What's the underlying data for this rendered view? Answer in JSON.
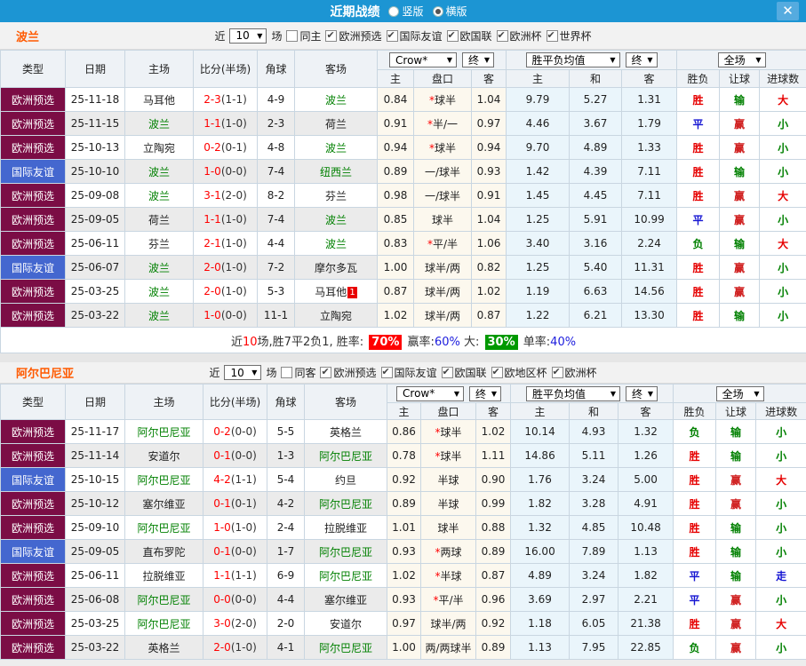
{
  "titlebar": {
    "title": "近期战绩",
    "radio_vertical": "竖版",
    "radio_horizontal": "横版",
    "selected_mode": "横版",
    "close_glyph": "✕"
  },
  "columns": {
    "type": "类型",
    "date": "日期",
    "home": "主场",
    "score": "比分(半场)",
    "corner": "角球",
    "away": "客场",
    "crow_select": "Crow*",
    "final_select": "终",
    "wdl_avg_select": "胜平负均值",
    "full_select": "全场",
    "odds_home": "主",
    "handicap": "盘口",
    "odds_away": "客",
    "avg_home": "主",
    "avg_draw": "和",
    "avg_away": "客",
    "result_wdl": "胜负",
    "result_handicap": "让球",
    "result_goals": "进球数"
  },
  "colors": {
    "titlebar_blue": "#1c95d3",
    "team_label_orange": "#ff5a00",
    "team_highlight_green": "#008000",
    "score_red": "#ff0000",
    "rate_red_bg": "#ff0000",
    "rate_green_bg": "#009900",
    "rate_blue_text": "#1c1cdd"
  },
  "type_bg_map": {
    "欧洲预选": "#7b0d45",
    "国际友谊": "#4467cf"
  },
  "result_color_map": {
    "胜": "#e60000",
    "负": "#008000",
    "平": "#1414d2",
    "赢": "#d02020",
    "输": "#008000",
    "走": "#1414d2",
    "大": "#e60000",
    "小": "#008000"
  },
  "sections": [
    {
      "team": "波兰",
      "filter": {
        "near_label": "近",
        "count": "10",
        "games_label": "场",
        "same_label": "同主",
        "same_checked": false,
        "competitions": [
          {
            "label": "欧洲预选",
            "checked": true
          },
          {
            "label": "国际友谊",
            "checked": true
          },
          {
            "label": "欧国联",
            "checked": true
          },
          {
            "label": "欧洲杯",
            "checked": true
          },
          {
            "label": "世界杯",
            "checked": true
          }
        ]
      },
      "rows": [
        {
          "type": "欧洲预选",
          "date": "25-11-18",
          "home": "马耳他",
          "home_active": false,
          "score": "2-3",
          "half": "(1-1)",
          "corners": "4-9",
          "away": "波兰",
          "away_active": true,
          "odds_home": "0.84",
          "handicap": "*球半",
          "odds_away": "1.04",
          "avg_home": "9.79",
          "avg_draw": "5.27",
          "avg_away": "1.31",
          "res_wdl": "胜",
          "res_handicap": "输",
          "res_goals": "大"
        },
        {
          "type": "欧洲预选",
          "date": "25-11-15",
          "home": "波兰",
          "home_active": true,
          "score": "1-1",
          "half": "(1-0)",
          "corners": "2-3",
          "away": "荷兰",
          "away_active": false,
          "odds_home": "0.91",
          "handicap": "*半/一",
          "odds_away": "0.97",
          "avg_home": "4.46",
          "avg_draw": "3.67",
          "avg_away": "1.79",
          "res_wdl": "平",
          "res_handicap": "赢",
          "res_goals": "小"
        },
        {
          "type": "欧洲预选",
          "date": "25-10-13",
          "home": "立陶宛",
          "home_active": false,
          "score": "0-2",
          "half": "(0-1)",
          "corners": "4-8",
          "away": "波兰",
          "away_active": true,
          "odds_home": "0.94",
          "handicap": "*球半",
          "odds_away": "0.94",
          "avg_home": "9.70",
          "avg_draw": "4.89",
          "avg_away": "1.33",
          "res_wdl": "胜",
          "res_handicap": "赢",
          "res_goals": "小"
        },
        {
          "type": "国际友谊",
          "date": "25-10-10",
          "home": "波兰",
          "home_active": true,
          "score": "1-0",
          "half": "(0-0)",
          "corners": "7-4",
          "away": "纽西兰",
          "away_active": true,
          "odds_home": "0.89",
          "handicap": "一/球半",
          "odds_away": "0.93",
          "avg_home": "1.42",
          "avg_draw": "4.39",
          "avg_away": "7.11",
          "res_wdl": "胜",
          "res_handicap": "输",
          "res_goals": "小"
        },
        {
          "type": "欧洲预选",
          "date": "25-09-08",
          "home": "波兰",
          "home_active": true,
          "score": "3-1",
          "half": "(2-0)",
          "corners": "8-2",
          "away": "芬兰",
          "away_active": false,
          "odds_home": "0.98",
          "handicap": "一/球半",
          "odds_away": "0.91",
          "avg_home": "1.45",
          "avg_draw": "4.45",
          "avg_away": "7.11",
          "res_wdl": "胜",
          "res_handicap": "赢",
          "res_goals": "大"
        },
        {
          "type": "欧洲预选",
          "date": "25-09-05",
          "home": "荷兰",
          "home_active": false,
          "score": "1-1",
          "half": "(1-0)",
          "corners": "7-4",
          "away": "波兰",
          "away_active": true,
          "odds_home": "0.85",
          "handicap": "球半",
          "odds_away": "1.04",
          "avg_home": "1.25",
          "avg_draw": "5.91",
          "avg_away": "10.99",
          "res_wdl": "平",
          "res_handicap": "赢",
          "res_goals": "小"
        },
        {
          "type": "欧洲预选",
          "date": "25-06-11",
          "home": "芬兰",
          "home_active": false,
          "score": "2-1",
          "half": "(1-0)",
          "corners": "4-4",
          "away": "波兰",
          "away_active": true,
          "odds_home": "0.83",
          "handicap": "*平/半",
          "odds_away": "1.06",
          "avg_home": "3.40",
          "avg_draw": "3.16",
          "avg_away": "2.24",
          "res_wdl": "负",
          "res_handicap": "输",
          "res_goals": "大"
        },
        {
          "type": "国际友谊",
          "date": "25-06-07",
          "home": "波兰",
          "home_active": true,
          "score": "2-0",
          "half": "(1-0)",
          "corners": "7-2",
          "away": "摩尔多瓦",
          "away_active": false,
          "odds_home": "1.00",
          "handicap": "球半/两",
          "odds_away": "0.82",
          "avg_home": "1.25",
          "avg_draw": "5.40",
          "avg_away": "11.31",
          "res_wdl": "胜",
          "res_handicap": "赢",
          "res_goals": "小"
        },
        {
          "type": "欧洲预选",
          "date": "25-03-25",
          "home": "波兰",
          "home_active": true,
          "score": "2-0",
          "half": "(1-0)",
          "corners": "5-3",
          "away": "马耳他",
          "away_active": false,
          "away_badge": "1",
          "odds_home": "0.87",
          "handicap": "球半/两",
          "odds_away": "1.02",
          "avg_home": "1.19",
          "avg_draw": "6.63",
          "avg_away": "14.56",
          "res_wdl": "胜",
          "res_handicap": "赢",
          "res_goals": "小"
        },
        {
          "type": "欧洲预选",
          "date": "25-03-22",
          "home": "波兰",
          "home_active": true,
          "score": "1-0",
          "half": "(0-0)",
          "corners": "11-1",
          "away": "立陶宛",
          "away_active": false,
          "odds_home": "1.02",
          "handicap": "球半/两",
          "odds_away": "0.87",
          "avg_home": "1.22",
          "avg_draw": "6.21",
          "avg_away": "13.30",
          "res_wdl": "胜",
          "res_handicap": "输",
          "res_goals": "小"
        }
      ],
      "summary": {
        "part1": "近",
        "count": "10",
        "part2": "场,胜7平2负1, 胜率:",
        "win_rate": "70%",
        "label_win": "赢率:",
        "win_pct": "60%",
        "label_big": "大:",
        "big_pct": "30%",
        "label_single": "单率:",
        "single_pct": "40%"
      }
    },
    {
      "team": "阿尔巴尼亚",
      "filter": {
        "near_label": "近",
        "count": "10",
        "games_label": "场",
        "same_label": "同客",
        "same_checked": false,
        "competitions": [
          {
            "label": "欧洲预选",
            "checked": true
          },
          {
            "label": "国际友谊",
            "checked": true
          },
          {
            "label": "欧国联",
            "checked": true
          },
          {
            "label": "欧地区杯",
            "checked": true
          },
          {
            "label": "欧洲杯",
            "checked": true
          }
        ]
      },
      "rows": [
        {
          "type": "欧洲预选",
          "date": "25-11-17",
          "home": "阿尔巴尼亚",
          "home_active": true,
          "score": "0-2",
          "half": "(0-0)",
          "corners": "5-5",
          "away": "英格兰",
          "away_active": false,
          "odds_home": "0.86",
          "handicap": "*球半",
          "odds_away": "1.02",
          "avg_home": "10.14",
          "avg_draw": "4.93",
          "avg_away": "1.32",
          "res_wdl": "负",
          "res_handicap": "输",
          "res_goals": "小"
        },
        {
          "type": "欧洲预选",
          "date": "25-11-14",
          "home": "安道尔",
          "home_active": false,
          "score": "0-1",
          "half": "(0-0)",
          "corners": "1-3",
          "away": "阿尔巴尼亚",
          "away_active": true,
          "odds_home": "0.78",
          "handicap": "*球半",
          "odds_away": "1.11",
          "avg_home": "14.86",
          "avg_draw": "5.11",
          "avg_away": "1.26",
          "res_wdl": "胜",
          "res_handicap": "输",
          "res_goals": "小"
        },
        {
          "type": "国际友谊",
          "date": "25-10-15",
          "home": "阿尔巴尼亚",
          "home_active": true,
          "score": "4-2",
          "half": "(1-1)",
          "corners": "5-4",
          "away": "约旦",
          "away_active": false,
          "odds_home": "0.92",
          "handicap": "半球",
          "odds_away": "0.90",
          "avg_home": "1.76",
          "avg_draw": "3.24",
          "avg_away": "5.00",
          "res_wdl": "胜",
          "res_handicap": "赢",
          "res_goals": "大"
        },
        {
          "type": "欧洲预选",
          "date": "25-10-12",
          "home": "塞尔维亚",
          "home_active": false,
          "score": "0-1",
          "half": "(0-1)",
          "corners": "4-2",
          "away": "阿尔巴尼亚",
          "away_active": true,
          "odds_home": "0.89",
          "handicap": "半球",
          "odds_away": "0.99",
          "avg_home": "1.82",
          "avg_draw": "3.28",
          "avg_away": "4.91",
          "res_wdl": "胜",
          "res_handicap": "赢",
          "res_goals": "小"
        },
        {
          "type": "欧洲预选",
          "date": "25-09-10",
          "home": "阿尔巴尼亚",
          "home_active": true,
          "score": "1-0",
          "half": "(1-0)",
          "corners": "2-4",
          "away": "拉脱维亚",
          "away_active": false,
          "odds_home": "1.01",
          "handicap": "球半",
          "odds_away": "0.88",
          "avg_home": "1.32",
          "avg_draw": "4.85",
          "avg_away": "10.48",
          "res_wdl": "胜",
          "res_handicap": "输",
          "res_goals": "小"
        },
        {
          "type": "国际友谊",
          "date": "25-09-05",
          "home": "直布罗陀",
          "home_active": false,
          "score": "0-1",
          "half": "(0-0)",
          "corners": "1-7",
          "away": "阿尔巴尼亚",
          "away_active": true,
          "odds_home": "0.93",
          "handicap": "*两球",
          "odds_away": "0.89",
          "avg_home": "16.00",
          "avg_draw": "7.89",
          "avg_away": "1.13",
          "res_wdl": "胜",
          "res_handicap": "输",
          "res_goals": "小"
        },
        {
          "type": "欧洲预选",
          "date": "25-06-11",
          "home": "拉脱维亚",
          "home_active": false,
          "score": "1-1",
          "half": "(1-1)",
          "corners": "6-9",
          "away": "阿尔巴尼亚",
          "away_active": true,
          "odds_home": "1.02",
          "handicap": "*半球",
          "odds_away": "0.87",
          "avg_home": "4.89",
          "avg_draw": "3.24",
          "avg_away": "1.82",
          "res_wdl": "平",
          "res_handicap": "输",
          "res_goals": "走"
        },
        {
          "type": "欧洲预选",
          "date": "25-06-08",
          "home": "阿尔巴尼亚",
          "home_active": true,
          "score": "0-0",
          "half": "(0-0)",
          "corners": "4-4",
          "away": "塞尔维亚",
          "away_active": false,
          "odds_home": "0.93",
          "handicap": "*平/半",
          "odds_away": "0.96",
          "avg_home": "3.69",
          "avg_draw": "2.97",
          "avg_away": "2.21",
          "res_wdl": "平",
          "res_handicap": "赢",
          "res_goals": "小"
        },
        {
          "type": "欧洲预选",
          "date": "25-03-25",
          "home": "阿尔巴尼亚",
          "home_active": true,
          "score": "3-0",
          "half": "(2-0)",
          "corners": "2-0",
          "away": "安道尔",
          "away_active": false,
          "odds_home": "0.97",
          "handicap": "球半/两",
          "odds_away": "0.92",
          "avg_home": "1.18",
          "avg_draw": "6.05",
          "avg_away": "21.38",
          "res_wdl": "胜",
          "res_handicap": "赢",
          "res_goals": "大"
        },
        {
          "type": "欧洲预选",
          "date": "25-03-22",
          "home": "英格兰",
          "home_active": false,
          "score": "2-0",
          "half": "(1-0)",
          "corners": "4-1",
          "away": "阿尔巴尼亚",
          "away_active": true,
          "odds_home": "1.00",
          "handicap": "两/两球半",
          "odds_away": "0.89",
          "avg_home": "1.13",
          "avg_draw": "7.95",
          "avg_away": "22.85",
          "res_wdl": "负",
          "res_handicap": "赢",
          "res_goals": "小"
        }
      ]
    }
  ]
}
